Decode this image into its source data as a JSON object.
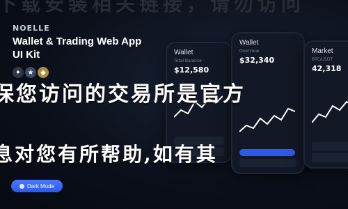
{
  "top_banner_text": "下载安装相关链接，请勿访问",
  "brand": {
    "name": "NOELLE",
    "headline": "Wallet & Trading Web App UI Kit"
  },
  "icons": [
    "bulb-icon",
    "star-icon",
    "diamond-icon"
  ],
  "button": {
    "label": "Dark Mode"
  },
  "phones": [
    {
      "title": "Wallet",
      "subtitle": "Total Balance",
      "value": "$12,580"
    },
    {
      "title": "Wallet",
      "subtitle": "Overview",
      "value": "$32,340"
    },
    {
      "title": "Market",
      "subtitle": "BTC/USDT",
      "value": "42,318"
    }
  ],
  "overlay": {
    "line_1": "保您访问的交易所是官方",
    "line_2": "息对您有所帮助,如有其"
  },
  "colors": {
    "accent": "#2b5bea",
    "background": "#0b0f1a",
    "chart_line": "#ffffff"
  }
}
